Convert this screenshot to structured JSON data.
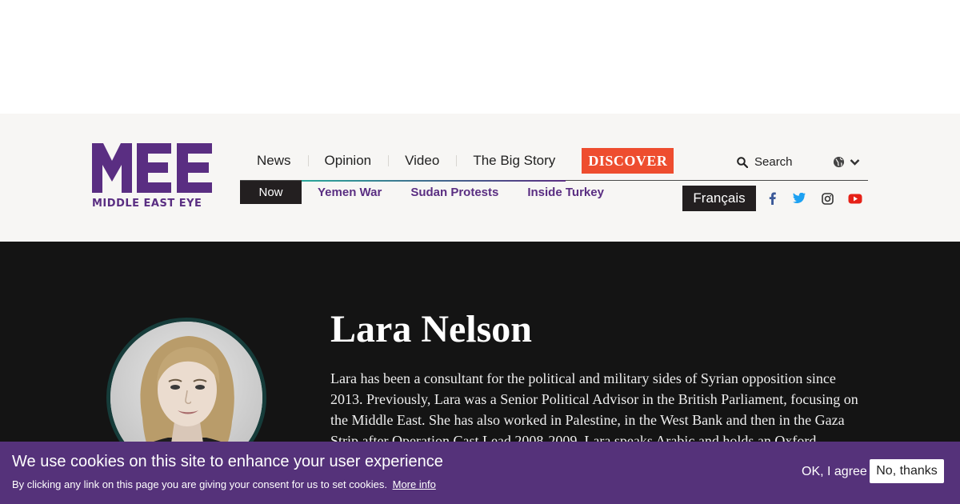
{
  "brand": {
    "logo_text": "MIDDLE EAST EYE",
    "logo_color": "#5a2e82"
  },
  "nav": {
    "main": [
      {
        "label": "News"
      },
      {
        "label": "Opinion"
      },
      {
        "label": "Video"
      },
      {
        "label": "The Big Story"
      }
    ],
    "discover_label": "DISCOVER",
    "sub": {
      "now_label": "Now",
      "links": [
        {
          "label": "Yemen War"
        },
        {
          "label": "Sudan Protests"
        },
        {
          "label": "Inside Turkey"
        }
      ]
    },
    "search_label": "Search",
    "language_button": "Français",
    "icons": {
      "search": "search-icon",
      "globe": "globe-icon",
      "chevron": "chevron-down-icon",
      "facebook": "facebook-icon",
      "twitter": "twitter-icon",
      "instagram": "instagram-icon",
      "youtube": "youtube-icon"
    }
  },
  "author": {
    "name": "Lara Nelson",
    "bio": "Lara has been a consultant for the political and military sides of Syrian opposition since 2013. Previously, Lara was a Senior Political Advisor in the British Parliament, focusing on the Middle East. She has also worked in Palestine, in the West Bank and then in the Gaza Strip after Operation Cast Lead 2008-2009. Lara speaks Arabic and holds an Oxford"
  },
  "cookie": {
    "title": "We use cookies on this site to enhance your user experience",
    "text": "By clicking any link on this page you are giving your consent for us to set cookies.",
    "more_info": "More info",
    "agree_label": "OK, I agree",
    "decline_label": "No, thanks"
  },
  "colors": {
    "accent_purple": "#5a2e82",
    "discover_red": "#ee4d2f",
    "dark": "#231f20",
    "cookie_bg": "#55327a",
    "facebook": "#3b5998",
    "twitter": "#1da1f2",
    "youtube": "#e62117"
  }
}
